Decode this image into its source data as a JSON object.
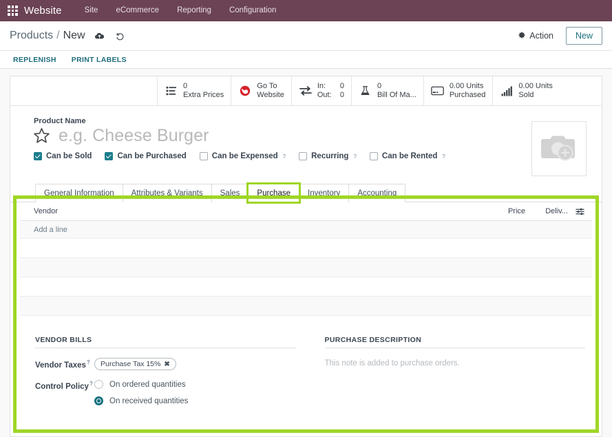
{
  "topbar": {
    "apps_icon": "apps-grid-icon",
    "brand": "Website",
    "menu": [
      {
        "label": "Site"
      },
      {
        "label": "eCommerce"
      },
      {
        "label": "Reporting"
      },
      {
        "label": "Configuration"
      }
    ]
  },
  "breadcrumb": {
    "parent": "Products",
    "separator": "/",
    "current": "New",
    "save_icon": "cloud-upload-icon",
    "discard_icon": "undo-icon"
  },
  "control_panel": {
    "action_label": "Action",
    "action_icon": "gear-icon",
    "new_label": "New"
  },
  "subbar": {
    "buttons": [
      {
        "label": "REPLENISH"
      },
      {
        "label": "PRINT LABELS"
      }
    ]
  },
  "stat_buttons": [
    {
      "icon": "",
      "value": "",
      "label": "",
      "empty": true
    },
    {
      "icon": "list-icon",
      "value": "0",
      "label": "Extra Prices"
    },
    {
      "icon": "globe-icon",
      "value": "Go To",
      "label": "Website"
    },
    {
      "icon": "exchange-arrows-icon",
      "value": "In:",
      "value2": "0",
      "label": "Out:",
      "label2": "0",
      "inout": true
    },
    {
      "icon": "flask-icon",
      "value": "0",
      "label": "Bill Of Ma..."
    },
    {
      "icon": "credit-card-icon",
      "value": "0.00 Units",
      "label": "Purchased"
    },
    {
      "icon": "bar-chart-icon",
      "value": "0.00 Units",
      "label": "Sold"
    }
  ],
  "product": {
    "name_label": "Product Name",
    "name_value": "",
    "name_placeholder": "e.g. Cheese Burger",
    "favorite_icon": "star-outline-icon",
    "image_icon": "camera-add-icon",
    "checkboxes": [
      {
        "label": "Can be Sold",
        "checked": true,
        "help": ""
      },
      {
        "label": "Can be Purchased",
        "checked": true,
        "help": ""
      },
      {
        "label": "Can be Expensed",
        "checked": false,
        "help": "?"
      },
      {
        "label": "Recurring",
        "checked": false,
        "help": "?"
      },
      {
        "label": "Can be Rented",
        "checked": false,
        "help": "?"
      }
    ]
  },
  "tabs": [
    {
      "label": "General Information",
      "active": false,
      "highlighted": false
    },
    {
      "label": "Attributes & Variants",
      "active": false,
      "highlighted": false
    },
    {
      "label": "Sales",
      "active": false,
      "highlighted": false
    },
    {
      "label": "Purchase",
      "active": true,
      "highlighted": true
    },
    {
      "label": "Inventory",
      "active": false,
      "highlighted": false
    },
    {
      "label": "Accounting",
      "active": false,
      "highlighted": false
    }
  ],
  "vendor_table": {
    "columns": {
      "vendor": "Vendor",
      "price": "Price",
      "delivery": "Deliv...",
      "options_icon": "column-options-icon"
    },
    "add_line_label": "Add a line",
    "rows": []
  },
  "vendor_bills": {
    "title": "VENDOR BILLS",
    "vendor_taxes_label": "Vendor Taxes",
    "vendor_taxes_help": "?",
    "vendor_taxes_tag": "Purchase Tax 15%",
    "vendor_taxes_tag_remove": "✖",
    "control_policy_label": "Control Policy",
    "control_policy_help": "?",
    "control_policy_options": [
      {
        "label": "On ordered quantities",
        "selected": false
      },
      {
        "label": "On received quantities",
        "selected": true
      }
    ]
  },
  "purchase_description": {
    "title": "PURCHASE DESCRIPTION",
    "note_placeholder": "This note is added to purchase orders."
  },
  "colors": {
    "topbar_bg": "#6b4354",
    "accent_teal": "#1d7d8c",
    "highlight_green": "#9fd626",
    "link_teal": "#1d6d7c"
  }
}
